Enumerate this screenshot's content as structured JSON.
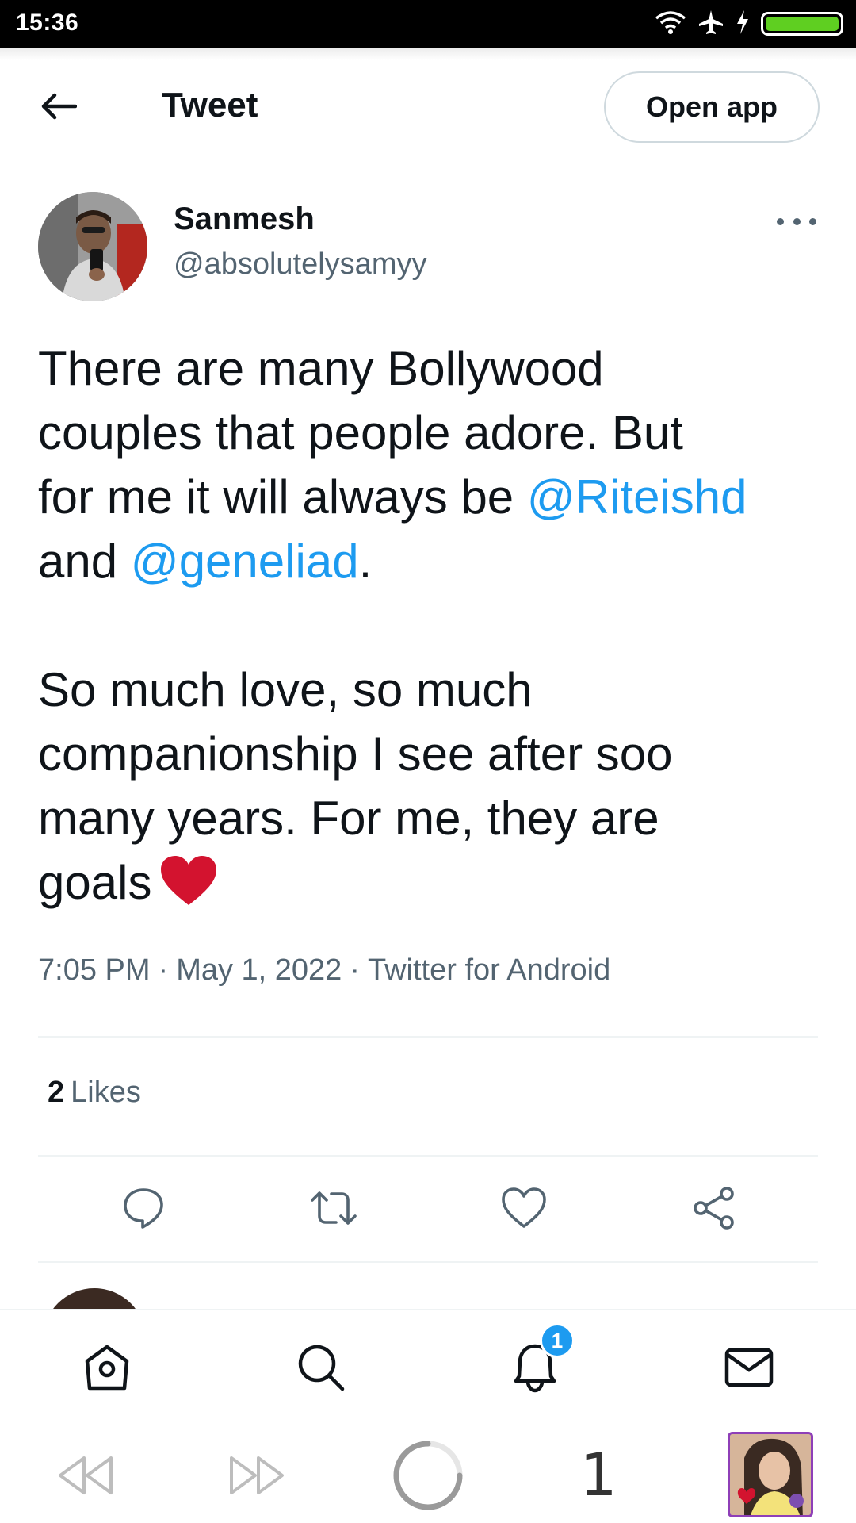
{
  "status_bar": {
    "time": "15:36"
  },
  "header": {
    "back_label": "",
    "title": "Tweet",
    "open_app": "Open app"
  },
  "author": {
    "name": "Sanmesh",
    "handle": "@absolutelysamyy"
  },
  "tweet": {
    "line1": "There are many Bollywood",
    "line2": "couples that people adore. But",
    "line3_prefix": "for me it will always be ",
    "mention1": "@Riteishd",
    "line4_prefix": "and ",
    "mention2": "@geneliad",
    "line4_suffix": ".",
    "line5": "So much love, so much",
    "line6": "companionship I see after soo",
    "line7": "many years. For me, they are",
    "line8": "goals"
  },
  "meta": {
    "time": "7:05 PM",
    "date": "May 1, 2022",
    "source": "Twitter for Android"
  },
  "likes": {
    "count": "2",
    "label": "Likes"
  },
  "actions": [
    "reply-icon",
    "retweet-icon",
    "like-icon",
    "share-icon"
  ],
  "tabbar": {
    "notification_badge": "1"
  },
  "system_bar": {
    "page_number": "1"
  },
  "colors": {
    "accent": "#1d9bf0",
    "heart": "#d3132f",
    "text": "#0f1419",
    "muted": "#536471"
  }
}
